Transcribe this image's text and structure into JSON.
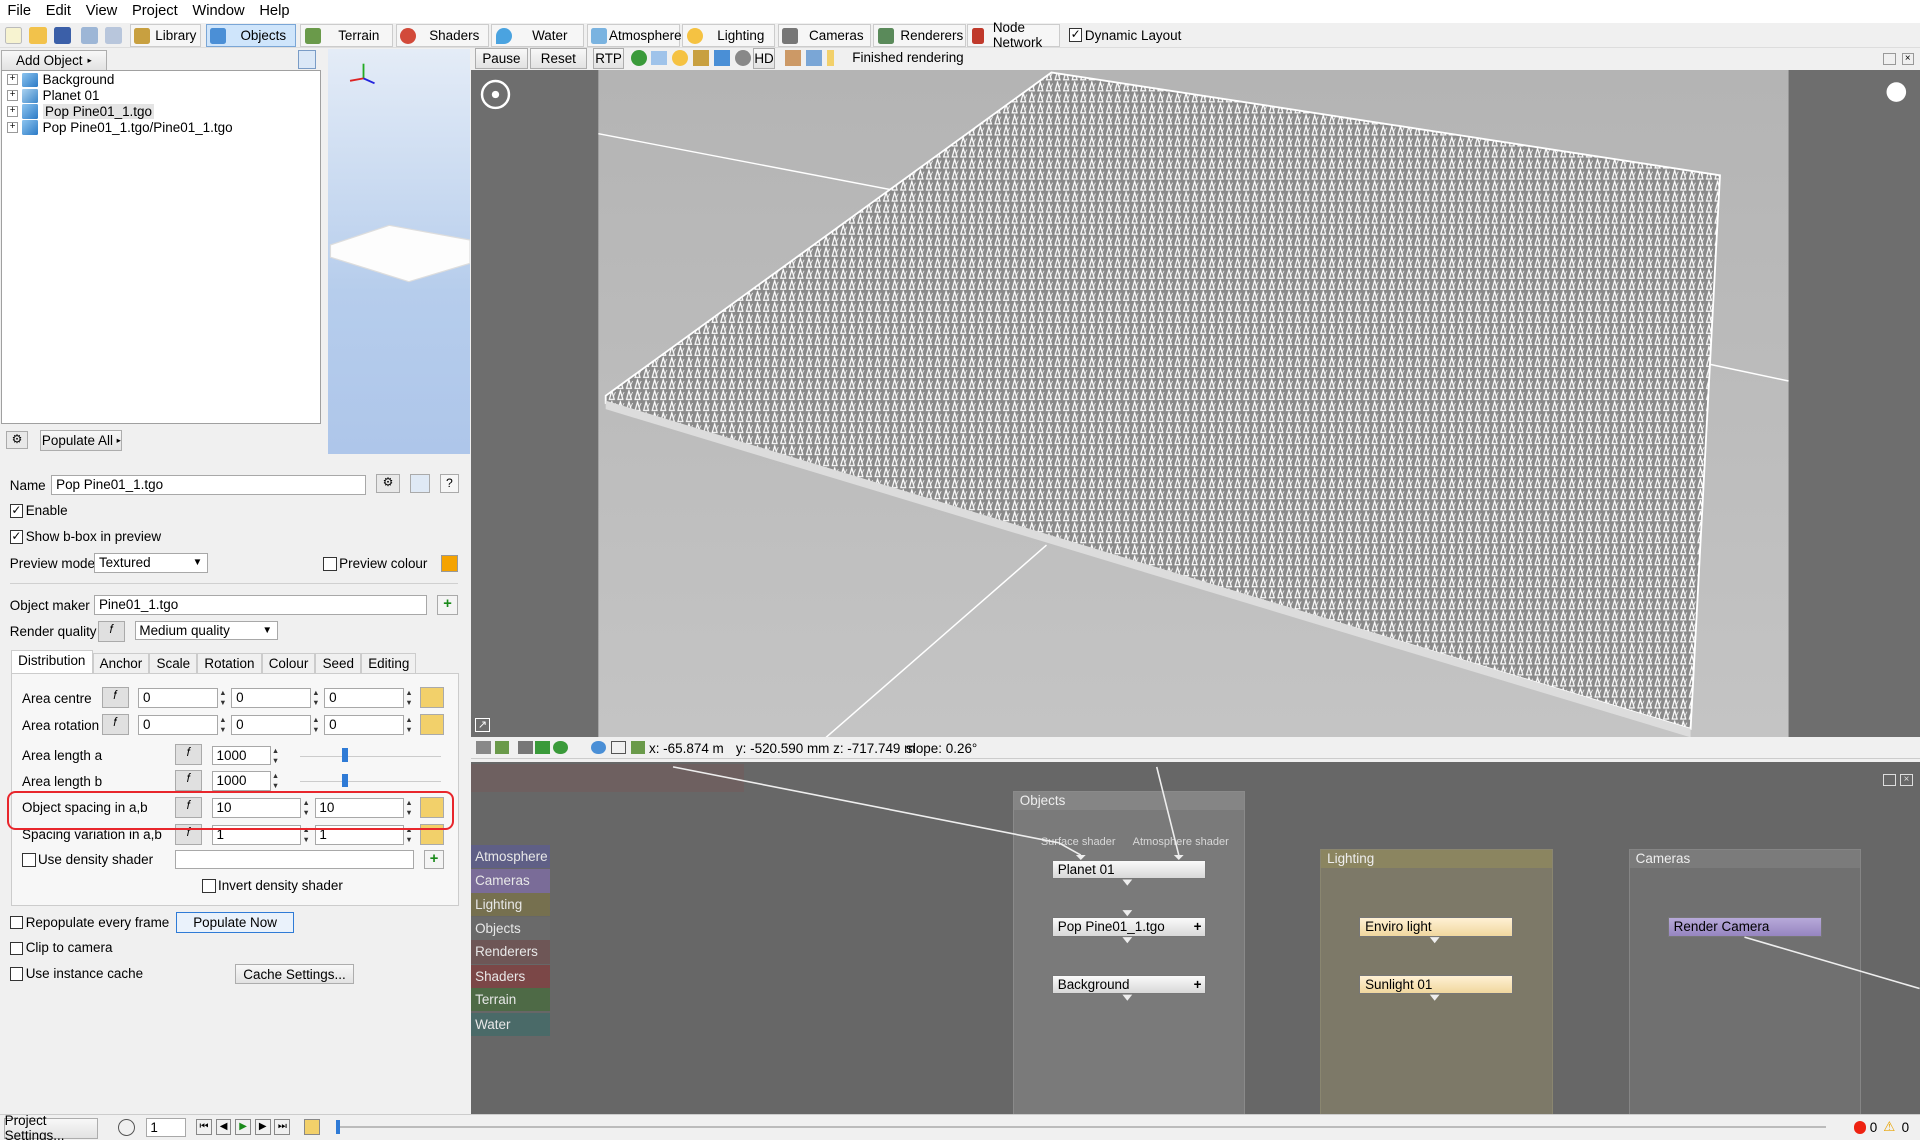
{
  "menu": [
    "File",
    "Edit",
    "View",
    "Project",
    "Window",
    "Help"
  ],
  "toolbar_tabs": [
    {
      "label": "Library",
      "icon": "library-icon"
    },
    {
      "label": "Objects",
      "icon": "objects-icon"
    },
    {
      "label": "Terrain",
      "icon": "terrain-icon"
    },
    {
      "label": "Shaders",
      "icon": "shaders-icon"
    },
    {
      "label": "Water",
      "icon": "water-icon"
    },
    {
      "label": "Atmosphere",
      "icon": "atmosphere-icon"
    },
    {
      "label": "Lighting",
      "icon": "lighting-icon"
    },
    {
      "label": "Cameras",
      "icon": "cameras-icon"
    },
    {
      "label": "Renderers",
      "icon": "renderers-icon"
    },
    {
      "label": "Node Network",
      "icon": "node-network-icon"
    }
  ],
  "dynamic_layout": "Dynamic Layout",
  "add_object": "Add Object",
  "tree": [
    "Background",
    "Planet 01",
    "Pop Pine01_1.tgo",
    "Pop Pine01_1.tgo/Pine01_1.tgo"
  ],
  "populate_all": "Populate All",
  "render_controls": {
    "pause": "Pause",
    "reset": "Reset",
    "rtp": "RTP",
    "hd": "HD",
    "status": "Finished rendering"
  },
  "coords": {
    "x": "x: -65.874 m",
    "yz": "y: -520.590 mm  z: -717.749 m",
    "slope": "slope: 0.26°"
  },
  "props": {
    "name_label": "Name",
    "name_value": "Pop Pine01_1.tgo",
    "enable": "Enable",
    "show_bbox": "Show b-box in preview",
    "preview_mode_label": "Preview mode",
    "preview_mode_value": "Textured",
    "preview_colour": "Preview colour",
    "preview_colour_hex": "#f5a300",
    "object_maker_label": "Object maker",
    "object_maker_value": "Pine01_1.tgo",
    "render_quality_label": "Render quality",
    "render_quality_value": "Medium quality",
    "tabs": [
      "Distribution",
      "Anchor",
      "Scale",
      "Rotation",
      "Colour",
      "Seed",
      "Editing"
    ],
    "area_centre": "Area centre",
    "area_centre_vals": [
      "0",
      "0",
      "0"
    ],
    "area_rotation": "Area rotation",
    "area_rotation_vals": [
      "0",
      "0",
      "0"
    ],
    "area_length_a": "Area length a",
    "area_length_a_val": "1000",
    "area_length_b": "Area length b",
    "area_length_b_val": "1000",
    "spacing": "Object spacing in a,b",
    "spacing_vals": [
      "10",
      "10"
    ],
    "spacing_var": "Spacing variation in a,b",
    "spacing_var_vals": [
      "1",
      "1"
    ],
    "density": "Use density shader",
    "invert_density": "Invert density shader",
    "repopulate": "Repopulate every frame",
    "populate_now": "Populate Now",
    "clip": "Clip to camera",
    "instance_cache": "Use instance cache",
    "cache_settings": "Cache Settings..."
  },
  "node_tabs": [
    {
      "label": "Atmosphere",
      "color": "#5f5f86"
    },
    {
      "label": "Cameras",
      "color": "#7a6c98"
    },
    {
      "label": "Lighting",
      "color": "#76704f"
    },
    {
      "label": "Objects",
      "color": "#6a6a6a"
    },
    {
      "label": "Renderers",
      "color": "#6e5656"
    },
    {
      "label": "Shaders",
      "color": "#7b4747"
    },
    {
      "label": "Terrain",
      "color": "#4e6a46"
    },
    {
      "label": "Water",
      "color": "#4a6a68"
    }
  ],
  "nodes": {
    "objects_group": "Objects",
    "surface_shader": "Surface shader",
    "atmosphere_shader": "Atmosphere shader",
    "planet": "Planet 01",
    "pop": "Pop Pine01_1.tgo",
    "background": "Background",
    "lighting_group": "Lighting",
    "enviro": "Enviro light",
    "sunlight": "Sunlight 01",
    "cameras_group": "Cameras",
    "render_camera": "Render Camera"
  },
  "bottom": {
    "project_settings": "Project Settings...",
    "frame": "1",
    "errors": "0",
    "warnings": "0"
  }
}
